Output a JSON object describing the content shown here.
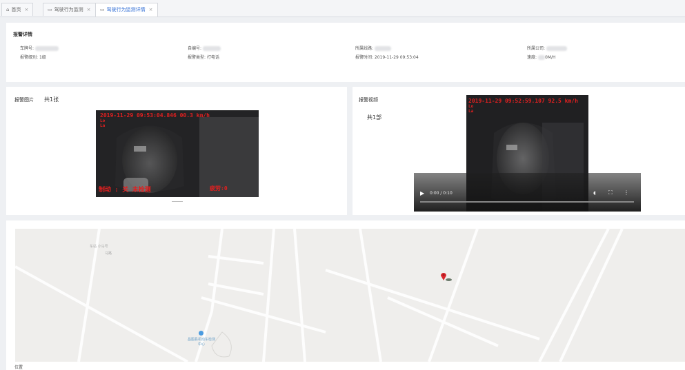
{
  "tabs": [
    {
      "label": "首页",
      "icon": "home-icon"
    },
    {
      "label": "驾驶行为监测",
      "icon": "monitor-icon"
    },
    {
      "label": "驾驶行为监测详情",
      "icon": "monitor-icon",
      "active": true
    }
  ],
  "alarm_detail": {
    "title": "报警详情",
    "plate_label": "车牌号:",
    "self_no_label": "自编号:",
    "route_label": "所属线路:",
    "company_label": "所属公司:",
    "level_label": "报警级别:",
    "level_value": "1级",
    "type_label": "报警类型:",
    "type_value": "打电话",
    "time_label": "报警时间:",
    "time_value": "2019-11-29 09:53:04",
    "speed_label": "速度:",
    "speed_value": "0M/H"
  },
  "alarm_image": {
    "title": "报警图片",
    "count": "共1张",
    "overlay_top": "2019-11-29 09:53:04.846 00.3 km/h",
    "overlay_lo": "Lo",
    "overlay_la": "La",
    "overlay_bottom_left": "制动 : 关  未检测",
    "overlay_bottom_right": "疲劳:0"
  },
  "alarm_video": {
    "title": "报警视频",
    "count": "共1部",
    "overlay_top": "2019-11-29 09:52:59.107 92.5 km/h",
    "overlay_lo": "Lo",
    "overlay_la": "La",
    "time_display": "0:00 / 0:10"
  },
  "map": {
    "labels": [
      "车站 小马号",
      "马路",
      "昌图县机动车检测中心"
    ],
    "marker": "location-pin"
  },
  "footer_label": "位置"
}
